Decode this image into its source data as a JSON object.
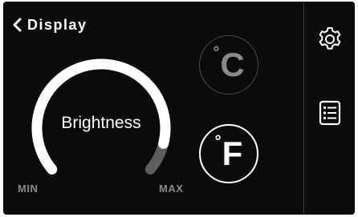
{
  "header": {
    "back_label": "Display",
    "back_icon": "chevron-left-icon"
  },
  "brightness": {
    "label": "Brightness",
    "min_label": "MIN",
    "max_label": "MAX",
    "level": 0.9
  },
  "units": {
    "celsius_label": "C",
    "fahrenheit_label": "F",
    "degree_symbol": "°",
    "selected": "F"
  },
  "sidebar": {
    "items": [
      {
        "icon": "gear-icon"
      },
      {
        "icon": "list-icon"
      }
    ]
  },
  "colors": {
    "background": "#0b0b0b",
    "active": "#ffffff",
    "inactive": "#8a8a8a",
    "gauge_track": "#5e5e5e"
  }
}
